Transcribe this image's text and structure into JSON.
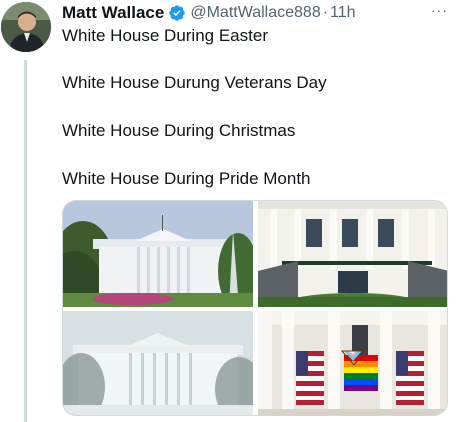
{
  "author": {
    "name": "Matt Wallace",
    "handle": "@MattWallace888",
    "separator": "·",
    "time": "11h",
    "verified_icon": "verified-badge-icon",
    "verified_color": "#1d9bf0"
  },
  "more_label": "···",
  "tweet_lines": [
    "White House During Easter",
    "White House Durung Veterans Day",
    "White House During Christmas",
    "White House During Pride Month"
  ],
  "media": {
    "images": [
      {
        "subject": "white-house-north-fountain"
      },
      {
        "subject": "white-house-portico"
      },
      {
        "subject": "white-house-snow"
      },
      {
        "subject": "white-house-flags"
      }
    ]
  },
  "colors": {
    "text": "#0f1419",
    "secondary": "#536471",
    "thread_line": "#cfd9de"
  }
}
